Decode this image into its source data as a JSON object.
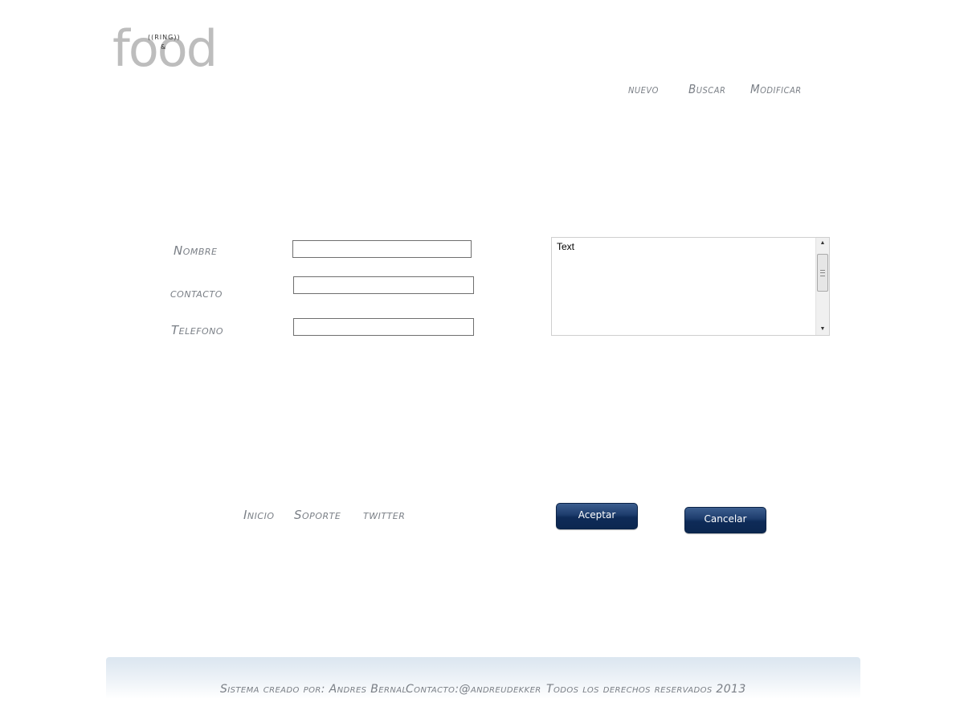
{
  "logo": {
    "word": "food",
    "ring": "((RING))",
    "amp": "&"
  },
  "menu": {
    "nuevo": "nuevo",
    "buscar": "Buscar",
    "modificar": "Modificar"
  },
  "form": {
    "nombre_label": "Nombre",
    "contacto_label": "contacto",
    "telefono_label": "Telefono",
    "nombre_value": "",
    "contacto_value": "",
    "telefono_value": "",
    "notes_value": "Text"
  },
  "footer_links": {
    "inicio": "Inicio",
    "soporte": "Soporte",
    "twitter": "twitter"
  },
  "buttons": {
    "aceptar": "Aceptar",
    "cancelar": "Cancelar"
  },
  "footer": {
    "credit": "Sistema creado por: Andres Bernal",
    "contact": "Contacto:@andreudekker",
    "rights": "Todos los derechos reservados  2013"
  },
  "colors": {
    "button": "#1d3c6c",
    "label_text": "#7a7f86",
    "logo": "#bdbdbd"
  },
  "icons": {
    "scroll_up": "scroll-up-arrow-icon",
    "scroll_down": "scroll-down-arrow-icon"
  }
}
